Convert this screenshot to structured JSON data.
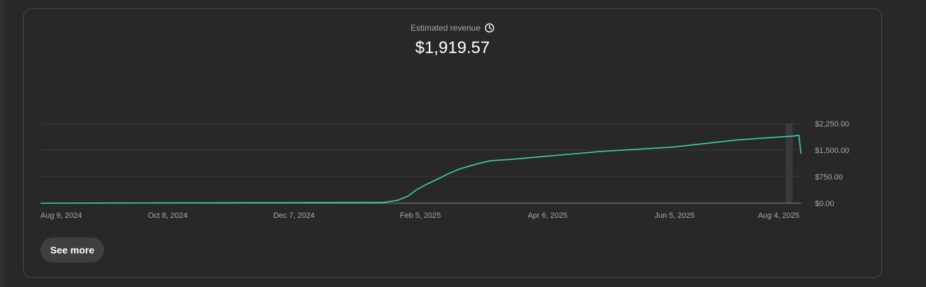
{
  "metric": {
    "label": "Estimated revenue",
    "value": "$1,919.57",
    "icon": "clock-icon"
  },
  "button": {
    "see_more": "See more"
  },
  "colors": {
    "line": "#3ecfb8",
    "grid": "#3a3a3a",
    "axis": "#8a8a8a",
    "text": "#aaaaaa",
    "highlight": "#3a3a3a"
  },
  "chart_data": {
    "type": "line",
    "title": "Estimated revenue",
    "xlabel": "",
    "ylabel": "",
    "x_tick_labels": [
      "Aug 9, 2024",
      "Oct 8, 2024",
      "Dec 7, 2024",
      "Feb 5, 2025",
      "Apr 6, 2025",
      "Jun 5, 2025",
      "Aug 4, 2025"
    ],
    "y_ticks": [
      0,
      750,
      1500,
      2250
    ],
    "y_tick_labels": [
      "$0.00",
      "$750.00",
      "$1,500.00",
      "$2,250.00"
    ],
    "ylim": [
      0,
      2250
    ],
    "xlim": [
      "2024-08-09",
      "2025-08-04"
    ],
    "grid": true,
    "series": [
      {
        "x": [
          "2024-08-09",
          "2025-01-18",
          "2025-01-25",
          "2025-01-30",
          "2025-02-03",
          "2025-02-08",
          "2025-02-13",
          "2025-02-18",
          "2025-02-23",
          "2025-02-28",
          "2025-03-05",
          "2025-03-10",
          "2025-03-20",
          "2025-04-06",
          "2025-05-01",
          "2025-06-05",
          "2025-07-05",
          "2025-08-01",
          "2025-08-03",
          "2025-08-04"
        ],
        "y": [
          0,
          20,
          80,
          200,
          380,
          540,
          680,
          830,
          960,
          1050,
          1130,
          1200,
          1240,
          1330,
          1460,
          1590,
          1790,
          1900,
          1919.57,
          1400
        ]
      }
    ]
  }
}
